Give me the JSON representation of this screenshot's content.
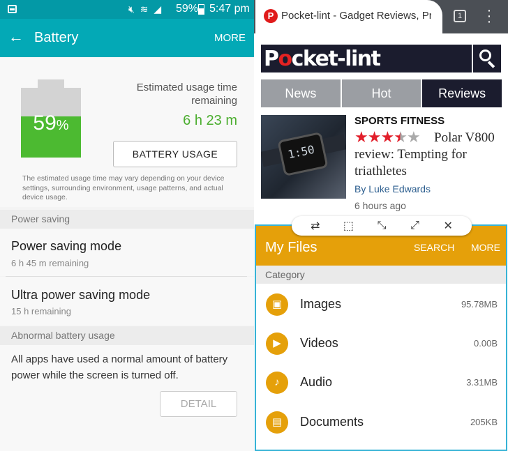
{
  "status_bar": {
    "battery_percent": "59%",
    "time": "5:47 pm"
  },
  "battery_screen": {
    "title": "Battery",
    "more_label": "MORE",
    "level_text": "59",
    "level_unit": "%",
    "level_fraction": 0.59,
    "estimated_label": "Estimated usage time remaining",
    "estimated_value": "6 h 23 m",
    "battery_usage_button": "BATTERY USAGE",
    "disclaimer": "The estimated usage time may vary depending on your device settings, surrounding environment, usage patterns, and actual device usage.",
    "power_saving_header": "Power saving",
    "power_saving_mode": {
      "title": "Power saving mode",
      "subtitle": "6 h 45 m remaining"
    },
    "ultra_power_saving_mode": {
      "title": "Ultra power saving mode",
      "subtitle": "15 h remaining"
    },
    "abnormal_header": "Abnormal battery usage",
    "abnormal_text": "All apps have used a normal amount of battery power while the screen is turned off.",
    "detail_button": "DETAIL"
  },
  "browser": {
    "tab_title": "Pocket-lint - Gadget Reviews, Pro",
    "tab_count": "1",
    "favicon_letter": "P",
    "logo_text_1": "P",
    "logo_text_o": "o",
    "logo_text_2": "cket-lint",
    "nav_tabs": [
      "News",
      "Hot",
      "Reviews"
    ],
    "article": {
      "category": "SPORTS FITNESS",
      "rating": 3.5,
      "title": "Polar V800 review: Tempting for triathletes",
      "author": "By Luke Edwards",
      "time": "6 hours ago",
      "image_face_text": "1:50"
    }
  },
  "my_files": {
    "title": "My Files",
    "search_label": "SEARCH",
    "more_label": "MORE",
    "category_header": "Category",
    "items": [
      {
        "name": "Images",
        "size": "95.78MB",
        "icon": "image-icon"
      },
      {
        "name": "Videos",
        "size": "0.00B",
        "icon": "video-icon"
      },
      {
        "name": "Audio",
        "size": "3.31MB",
        "icon": "music-note-icon"
      },
      {
        "name": "Documents",
        "size": "205KB",
        "icon": "document-icon"
      }
    ]
  },
  "colors": {
    "teal_header": "#03a9b6",
    "battery_green": "#4cba31",
    "files_accent": "#e5a00a",
    "site_dark": "#1b1c2e",
    "star_red": "#e21f2b"
  }
}
